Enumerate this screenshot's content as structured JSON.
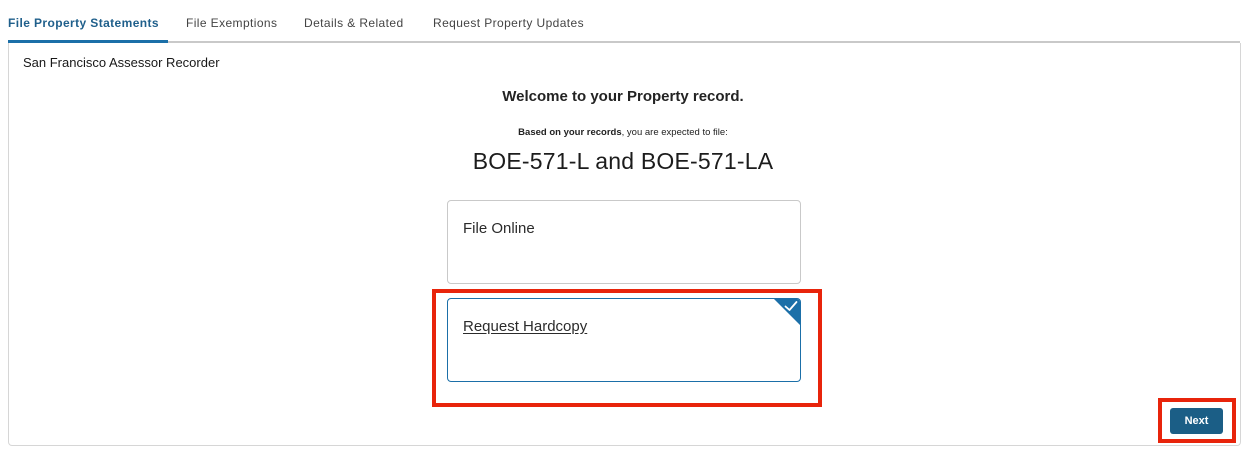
{
  "tabs": [
    {
      "label": "File Property Statements",
      "active": true
    },
    {
      "label": "File Exemptions",
      "active": false
    },
    {
      "label": "Details & Related",
      "active": false
    },
    {
      "label": "Request Property Updates",
      "active": false
    }
  ],
  "panel": {
    "org_name": "San Francisco Assessor Recorder",
    "welcome": "Welcome to your Property record.",
    "expect_bold": "Based on your records",
    "expect_rest": ", you are expected to file:",
    "forms": "BOE-571-L and BOE-571-LA"
  },
  "options": [
    {
      "label": "File Online",
      "selected": false
    },
    {
      "label": "Request Hardcopy",
      "selected": true
    }
  ],
  "actions": {
    "next_label": "Next"
  },
  "icons": {
    "selected_check": "checkmark-icon"
  },
  "colors": {
    "accent": "#1b6fa8",
    "button": "#1b5e86",
    "highlight": "#e8240b",
    "active_tab_text": "#1f5f8b"
  }
}
